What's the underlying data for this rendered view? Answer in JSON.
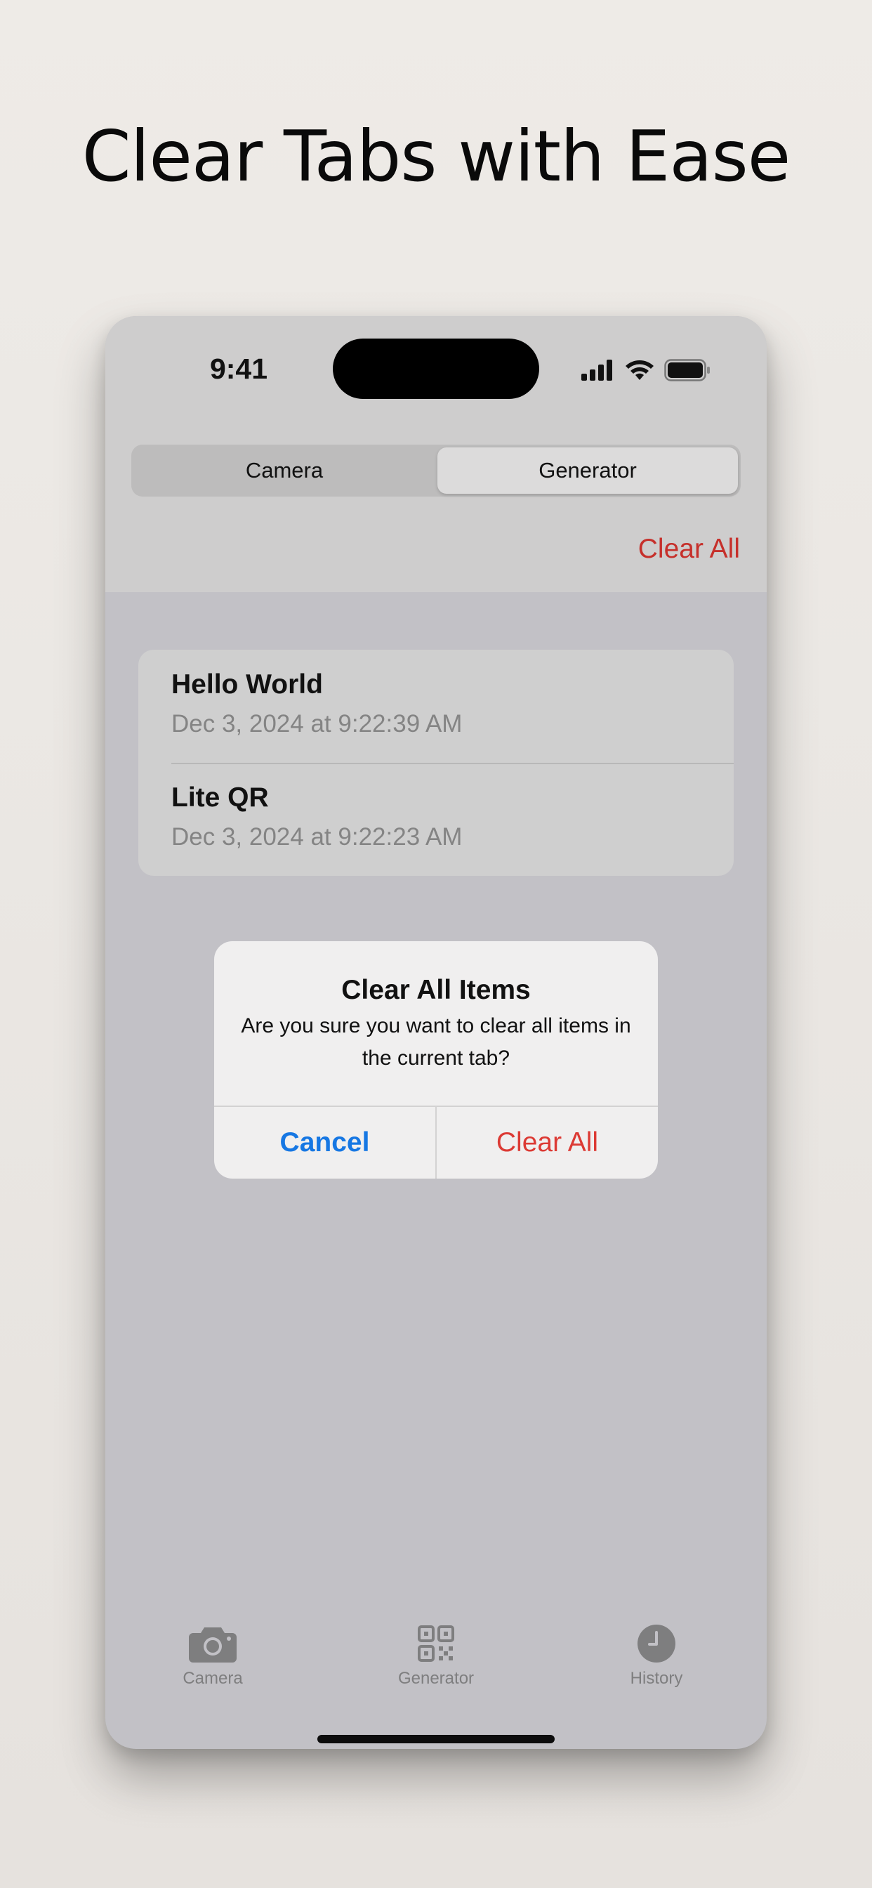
{
  "headline": "Clear Tabs with Ease",
  "status_bar": {
    "time": "9:41"
  },
  "segmented_control": {
    "options": [
      "Camera",
      "Generator"
    ],
    "selected": "Generator"
  },
  "toolbar": {
    "clear_all_label": "Clear All"
  },
  "history_items": [
    {
      "title": "Hello World",
      "date": "Dec 3, 2024 at 9:22:39 AM"
    },
    {
      "title": "Lite QR",
      "date": "Dec 3, 2024 at 9:22:23 AM"
    }
  ],
  "alert": {
    "title": "Clear All Items",
    "message": "Are you sure you want to clear all items in the current tab?",
    "cancel_label": "Cancel",
    "confirm_label": "Clear All"
  },
  "tab_bar": {
    "items": [
      {
        "label": "Camera",
        "icon": "camera-icon"
      },
      {
        "label": "Generator",
        "icon": "qr-code-icon"
      },
      {
        "label": "History",
        "icon": "clock-icon"
      }
    ]
  },
  "colors": {
    "destructive": "#dc3a34",
    "accent_blue": "#1677e3",
    "tab_inactive": "#7e7e7f"
  }
}
